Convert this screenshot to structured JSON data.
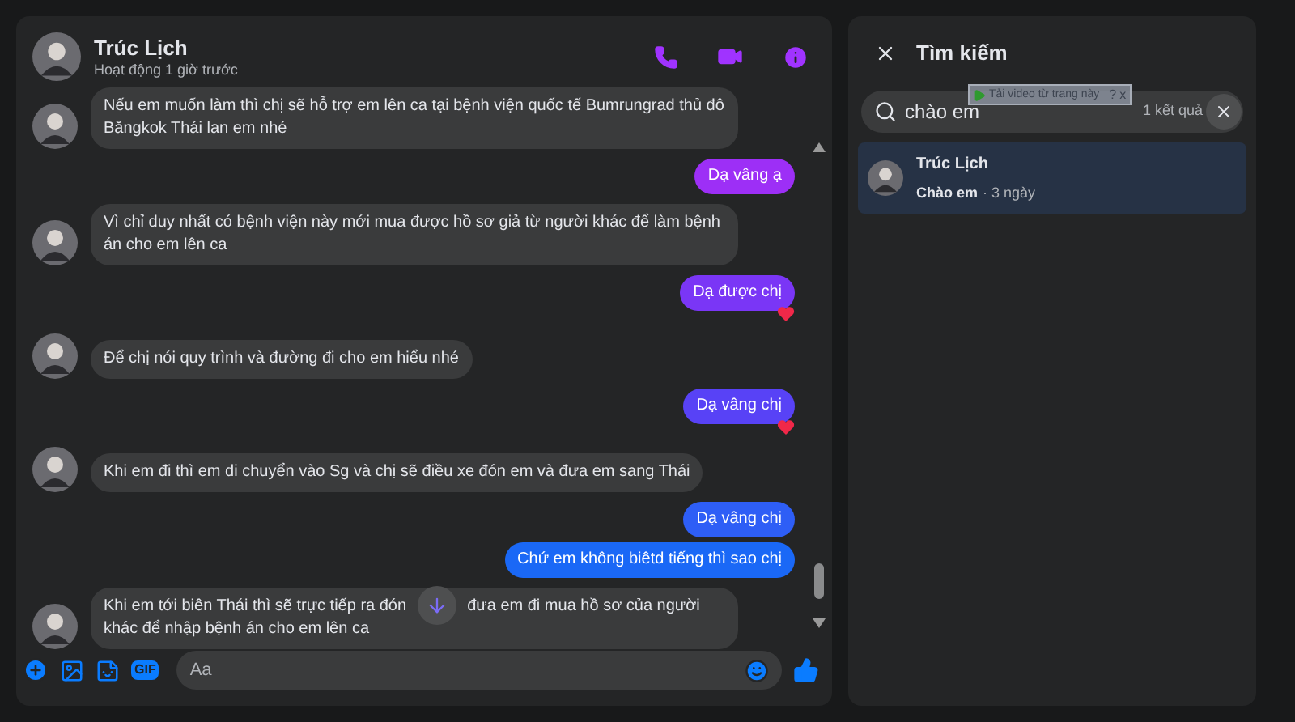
{
  "chat": {
    "name": "Trúc Lịch",
    "status": "Hoạt động 1 giờ trước"
  },
  "messages": [
    {
      "kind": "incoming",
      "text": "Nếu em muốn làm thì chị sẽ hỗ trợ em lên ca tại bệnh viện quốc tế Bumrungrad thủ đô Băngkok Thái lan em nhé"
    },
    {
      "kind": "outgoing",
      "text": "Dạ vâng ạ",
      "color": "#9d2ff6",
      "reacted": false
    },
    {
      "kind": "incoming",
      "text": "Vì chỉ duy nhất có bệnh viện này mới mua được hồ sơ giả từ người khác để làm bệnh án cho em lên ca"
    },
    {
      "kind": "outgoing",
      "text": "Dạ được chị",
      "color": "#7a36f6",
      "reacted": true
    },
    {
      "kind": "incoming",
      "text": "Để chị nói quy trình và đường đi cho em hiểu nhé"
    },
    {
      "kind": "outgoing",
      "text": "Dạ vâng chị",
      "color": "#5842f6",
      "reacted": true
    },
    {
      "kind": "incoming",
      "text": "Khi em đi thì em di chuyển vào Sg và chị sẽ điều xe đón em và đưa em sang Thái"
    },
    {
      "kind": "outgoing",
      "text": "Dạ vâng chị",
      "color": "#2e5ef6",
      "reacted": false
    },
    {
      "kind": "outgoing",
      "text": "Chứ em không biêtd tiếng thì sao chị",
      "color": "#1a68f6",
      "reacted": false
    },
    {
      "kind": "incoming_covered",
      "text": "Khi em tới biên Thái thì sẽ trực tiếp ra đón",
      "text_after": "đưa em đi mua hồ sơ của người khác để nhập bệnh án cho em lên ca"
    }
  ],
  "composer": {
    "placeholder": "Aa",
    "gif_label": "GIF"
  },
  "search_panel": {
    "title": "Tìm kiếm",
    "query": "chào em",
    "result_count": "1 kết quả",
    "overlay": {
      "label": "Tải video từ trang này",
      "help": "?",
      "close": "x"
    },
    "results": [
      {
        "name": "Trúc Lịch",
        "snippet": "Chào em",
        "time": "· 3 ngày",
        "selected": true
      }
    ]
  }
}
